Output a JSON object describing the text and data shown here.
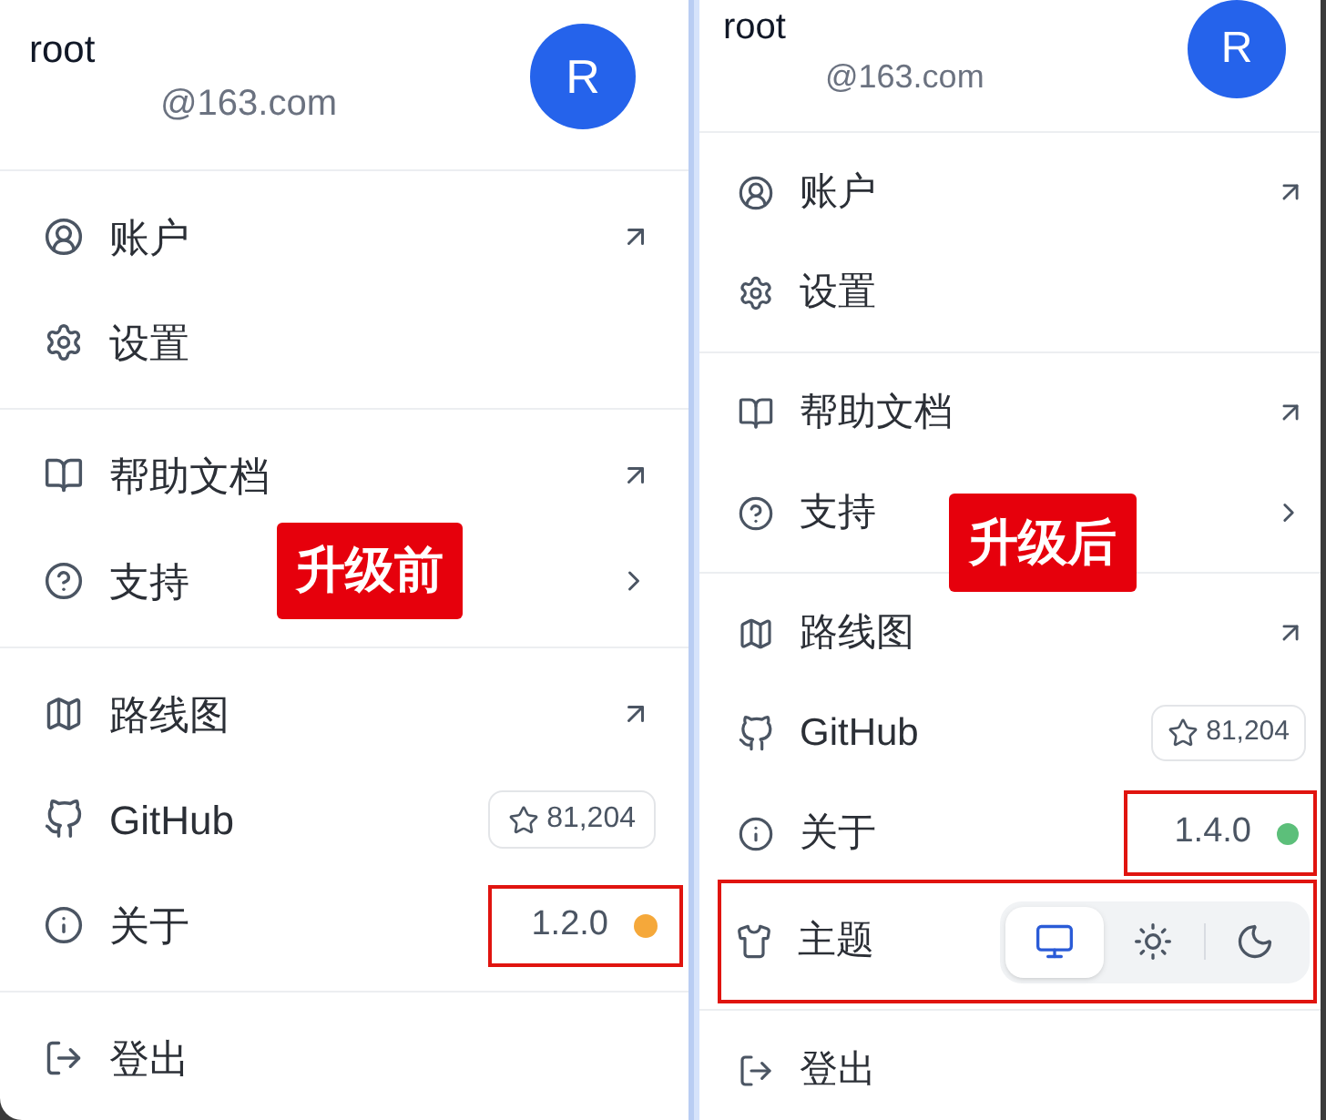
{
  "panels": [
    {
      "user": {
        "name": "root",
        "email": "@163.com",
        "avatar": "R"
      },
      "sections": [
        {
          "items": [
            {
              "kind": "account",
              "label": "账户",
              "highlighted": false
            },
            {
              "kind": "settings",
              "label": "设置",
              "highlighted": false
            }
          ]
        },
        {
          "items": [
            {
              "kind": "docs",
              "label": "帮助文档",
              "highlighted": false
            },
            {
              "kind": "support",
              "label": "支持",
              "highlighted": false
            }
          ]
        },
        {
          "items": [
            {
              "kind": "roadmap",
              "label": "路线图",
              "highlighted": false
            },
            {
              "kind": "github",
              "label": "GitHub",
              "star_count": "81,204",
              "highlighted": false
            },
            {
              "kind": "about",
              "label": "关于",
              "version": "1.2.0",
              "color": "#f5a83a",
              "highlighted": true
            }
          ]
        },
        {
          "items": [
            {
              "kind": "logout",
              "label": "登出",
              "highlighted": false
            }
          ]
        }
      ],
      "annotation": {
        "label": "升级前"
      }
    },
    {
      "user": {
        "name": "root",
        "email": "@163.com",
        "avatar": "R"
      },
      "sections": [
        {
          "items": [
            {
              "kind": "account",
              "label": "账户",
              "highlighted": false
            },
            {
              "kind": "settings",
              "label": "设置",
              "highlighted": false
            }
          ]
        },
        {
          "items": [
            {
              "kind": "docs",
              "label": "帮助文档",
              "highlighted": false
            },
            {
              "kind": "support",
              "label": "支持",
              "highlighted": false
            }
          ]
        },
        {
          "items": [
            {
              "kind": "roadmap",
              "label": "路线图",
              "highlighted": false
            },
            {
              "kind": "github",
              "label": "GitHub",
              "star_count": "81,204",
              "highlighted": false
            },
            {
              "kind": "about",
              "label": "关于",
              "version": "1.4.0",
              "color": "#5cbf7a",
              "highlighted": true
            },
            {
              "kind": "theme",
              "label": "主题",
              "highlighted": true,
              "options": [
                {
                  "kind": "system",
                  "selected": true
                },
                {
                  "kind": "light",
                  "selected": false
                },
                {
                  "kind": "dark",
                  "selected": false
                }
              ]
            }
          ]
        },
        {
          "items": [
            {
              "kind": "logout",
              "label": "登出",
              "highlighted": false
            }
          ]
        }
      ],
      "annotation": {
        "label": "升级后"
      }
    }
  ]
}
